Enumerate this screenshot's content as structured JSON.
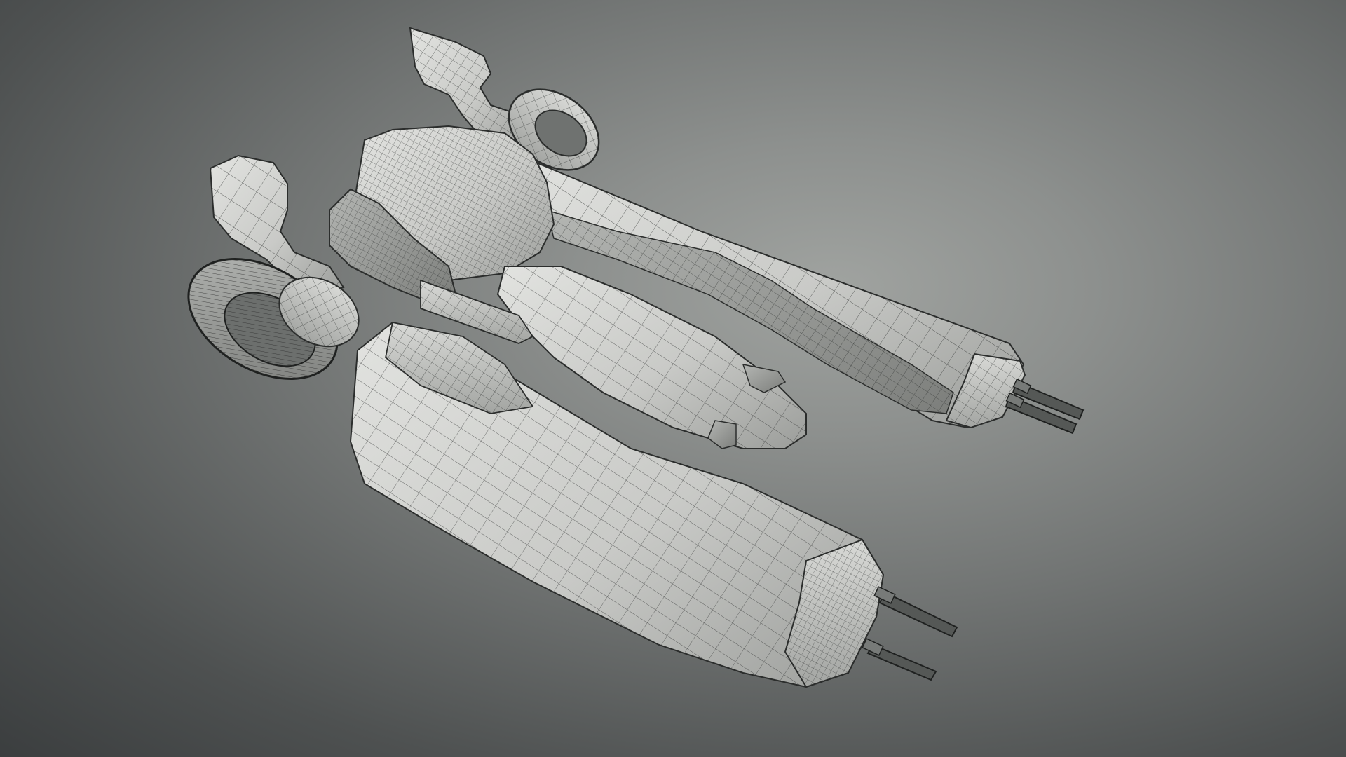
{
  "viewport": {
    "content": "3d-wireframe-render",
    "subject": "hover-bike-model",
    "shading": "clay-with-wireframe-overlay",
    "colors": {
      "background_light": "#a0a3a0",
      "background_dark": "#3b3e3f",
      "model_base": "#cfd0cd",
      "model_shadow": "#8c8e8b",
      "wireframe": "#2b2d2c"
    }
  }
}
